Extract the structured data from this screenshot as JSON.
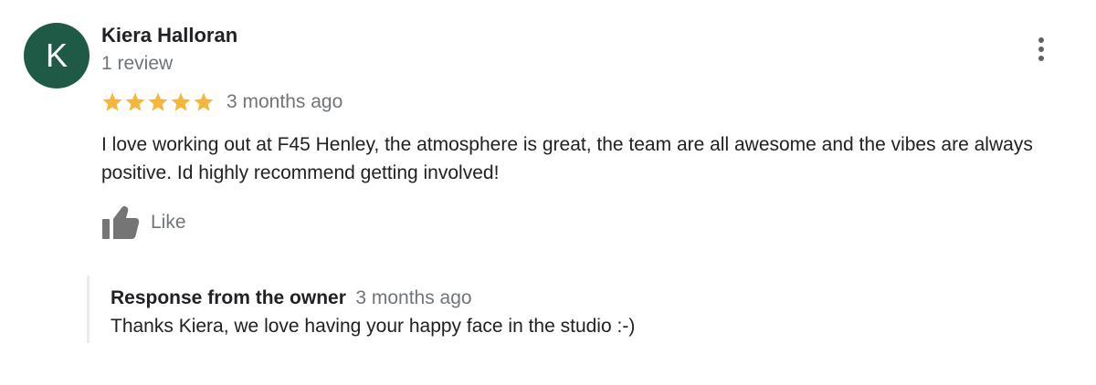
{
  "review": {
    "avatar_initial": "K",
    "avatar_color": "#1e5a45",
    "reviewer_name": "Kiera Halloran",
    "review_count": "1 review",
    "rating": 5,
    "rating_max": 5,
    "star_color": "#f4b73b",
    "date": "3 months ago",
    "text": "I love working out at F45 Henley, the atmosphere is great, the team are all awesome and the vibes are always positive. Id highly recommend getting involved!",
    "like_label": "Like",
    "more_icon": "more-vert-icon",
    "like_icon": "thumbs-up-icon"
  },
  "owner_response": {
    "title": "Response from the owner",
    "date": "3 months ago",
    "text": "Thanks Kiera, we love having your happy face in the studio :-)"
  }
}
